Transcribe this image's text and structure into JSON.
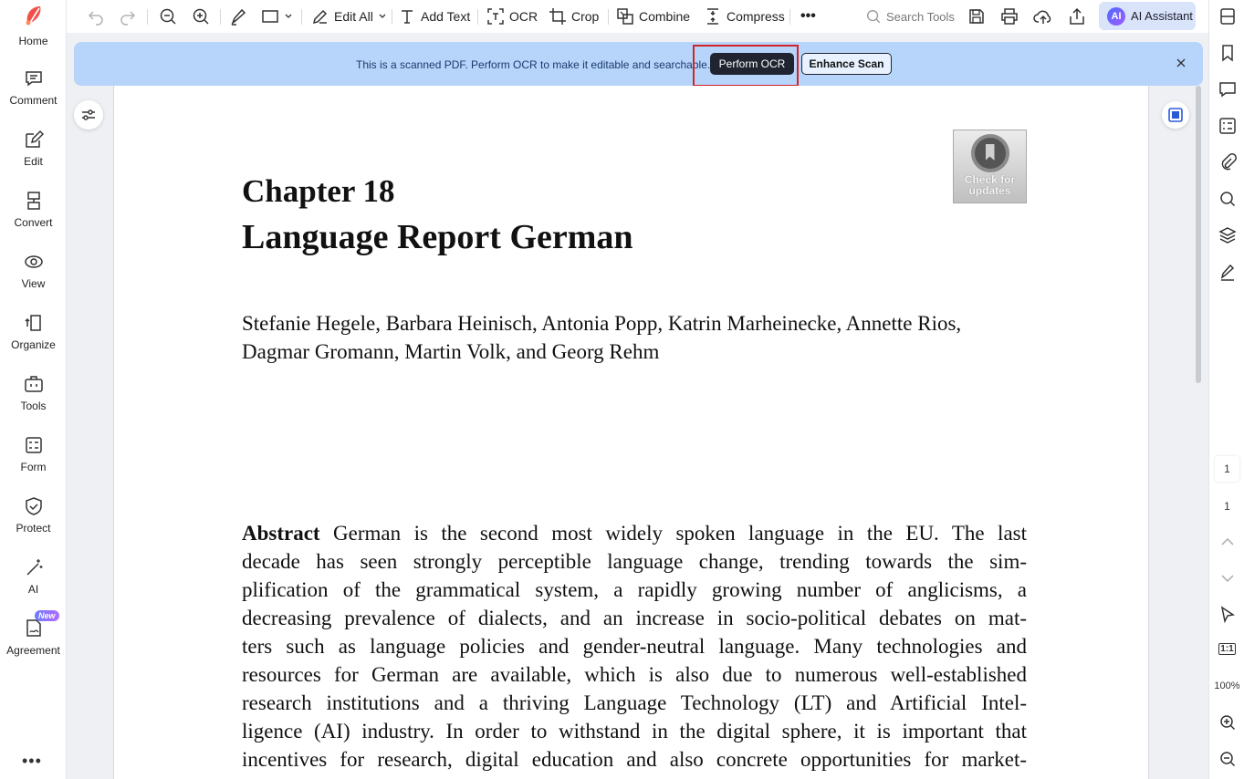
{
  "sidebar": {
    "items": [
      {
        "label": "Home"
      },
      {
        "label": "Comment"
      },
      {
        "label": "Edit"
      },
      {
        "label": "Convert"
      },
      {
        "label": "View"
      },
      {
        "label": "Organize"
      },
      {
        "label": "Tools"
      },
      {
        "label": "Form"
      },
      {
        "label": "Protect"
      },
      {
        "label": "AI"
      },
      {
        "label": "Agreement",
        "badge": "New"
      }
    ],
    "more": "•••"
  },
  "toolbar": {
    "edit_all": "Edit All",
    "add_text": "Add Text",
    "ocr": "OCR",
    "crop": "Crop",
    "combine": "Combine",
    "compress": "Compress",
    "more": "•••",
    "search_tools": "Search Tools",
    "ai_assistant": "AI Assistant",
    "ai_logo": "AI"
  },
  "banner": {
    "message": "This is a scanned PDF. Perform OCR to make it editable and searchable.",
    "perform_ocr": "Perform OCR",
    "enhance_scan": "Enhance Scan"
  },
  "document": {
    "chapter": "Chapter 18",
    "title": "Language Report German",
    "authors": "Stefanie Hegele, Barbara Heinisch, Antonia Popp, Katrin Marheinecke, Annette Rios, Dagmar Gromann, Martin Volk, and Georg Rehm",
    "check_updates_line1": "Check for",
    "check_updates_line2": "updates",
    "abstract_label": "Abstract",
    "abstract_lines": [
      " German is the second most widely spoken language in the EU. The last",
      "decade has seen strongly perceptible language change, trending towards the sim-",
      "plification of the grammatical system, a rapidly growing number of anglicisms, a",
      "decreasing prevalence of dialects, and an increase in socio-political debates on mat-",
      "ters such as language policies and gender-neutral language. Many technologies and",
      "resources for German are available, which is also due to numerous well-established",
      "research institutions and a thriving Language Technology (LT) and Artificial Intel-",
      "ligence (AI) industry. In order to withstand in the digital sphere, it is important that",
      "incentives for research, digital education and also concrete opportunities for market-"
    ]
  },
  "right_rail": {
    "current_page": "1",
    "total_pages": "1",
    "fit_label": "1:1",
    "zoom": "100%"
  }
}
